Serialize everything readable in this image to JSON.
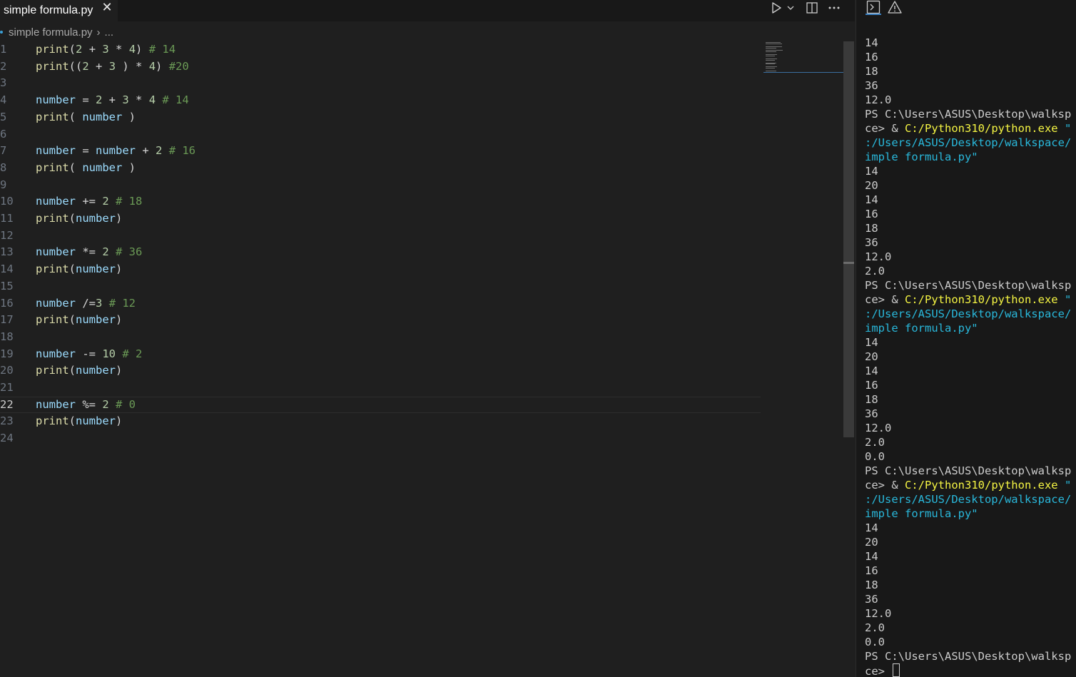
{
  "tab": {
    "label": "simple formula.py",
    "close_glyph": "✕"
  },
  "toolbar": {
    "run_icon": "play-icon",
    "run_dropdown_icon": "chevron-down-icon",
    "split_icon": "split-editor-icon",
    "more_icon": "ellipsis-icon"
  },
  "breadcrumb": {
    "file": "simple formula.py",
    "separator": "›",
    "more": "..."
  },
  "editor": {
    "current_line": 22,
    "lines": [
      {
        "n": "1",
        "tokens": [
          [
            "fn",
            "print"
          ],
          [
            "op",
            "("
          ],
          [
            "num",
            "2"
          ],
          [
            "op",
            " + "
          ],
          [
            "num",
            "3"
          ],
          [
            "op",
            " * "
          ],
          [
            "num",
            "4"
          ],
          [
            "op",
            ") "
          ],
          [
            "com",
            "# 14"
          ]
        ]
      },
      {
        "n": "2",
        "tokens": [
          [
            "fn",
            "print"
          ],
          [
            "op",
            "(("
          ],
          [
            "num",
            "2"
          ],
          [
            "op",
            " + "
          ],
          [
            "num",
            "3"
          ],
          [
            "op",
            " ) * "
          ],
          [
            "num",
            "4"
          ],
          [
            "op",
            ") "
          ],
          [
            "com",
            "#20"
          ]
        ]
      },
      {
        "n": "3",
        "tokens": []
      },
      {
        "n": "4",
        "tokens": [
          [
            "var",
            "number"
          ],
          [
            "op",
            " = "
          ],
          [
            "num",
            "2"
          ],
          [
            "op",
            " + "
          ],
          [
            "num",
            "3"
          ],
          [
            "op",
            " * "
          ],
          [
            "num",
            "4"
          ],
          [
            "op",
            " "
          ],
          [
            "com",
            "# 14"
          ]
        ]
      },
      {
        "n": "5",
        "tokens": [
          [
            "fn",
            "print"
          ],
          [
            "op",
            "( "
          ],
          [
            "var",
            "number"
          ],
          [
            "op",
            " )"
          ]
        ]
      },
      {
        "n": "6",
        "tokens": []
      },
      {
        "n": "7",
        "tokens": [
          [
            "var",
            "number"
          ],
          [
            "op",
            " = "
          ],
          [
            "var",
            "number"
          ],
          [
            "op",
            " + "
          ],
          [
            "num",
            "2"
          ],
          [
            "op",
            " "
          ],
          [
            "com",
            "# 16"
          ]
        ]
      },
      {
        "n": "8",
        "tokens": [
          [
            "fn",
            "print"
          ],
          [
            "op",
            "( "
          ],
          [
            "var",
            "number"
          ],
          [
            "op",
            " )"
          ]
        ]
      },
      {
        "n": "9",
        "tokens": []
      },
      {
        "n": "10",
        "tokens": [
          [
            "var",
            "number"
          ],
          [
            "op",
            " += "
          ],
          [
            "num",
            "2"
          ],
          [
            "op",
            " "
          ],
          [
            "com",
            "# 18"
          ]
        ]
      },
      {
        "n": "11",
        "tokens": [
          [
            "fn",
            "print"
          ],
          [
            "op",
            "("
          ],
          [
            "var",
            "number"
          ],
          [
            "op",
            ")"
          ]
        ]
      },
      {
        "n": "12",
        "tokens": []
      },
      {
        "n": "13",
        "tokens": [
          [
            "var",
            "number"
          ],
          [
            "op",
            " *= "
          ],
          [
            "num",
            "2"
          ],
          [
            "op",
            " "
          ],
          [
            "com",
            "# 36"
          ]
        ]
      },
      {
        "n": "14",
        "tokens": [
          [
            "fn",
            "print"
          ],
          [
            "op",
            "("
          ],
          [
            "var",
            "number"
          ],
          [
            "op",
            ")"
          ]
        ]
      },
      {
        "n": "15",
        "tokens": []
      },
      {
        "n": "16",
        "tokens": [
          [
            "var",
            "number"
          ],
          [
            "op",
            " /="
          ],
          [
            "num",
            "3"
          ],
          [
            "op",
            " "
          ],
          [
            "com",
            "# 12"
          ]
        ]
      },
      {
        "n": "17",
        "tokens": [
          [
            "fn",
            "print"
          ],
          [
            "op",
            "("
          ],
          [
            "var",
            "number"
          ],
          [
            "op",
            ")"
          ]
        ]
      },
      {
        "n": "18",
        "tokens": []
      },
      {
        "n": "19",
        "tokens": [
          [
            "var",
            "number"
          ],
          [
            "op",
            " -= "
          ],
          [
            "num",
            "10"
          ],
          [
            "op",
            " "
          ],
          [
            "com",
            "# 2"
          ]
        ]
      },
      {
        "n": "20",
        "tokens": [
          [
            "fn",
            "print"
          ],
          [
            "op",
            "("
          ],
          [
            "var",
            "number"
          ],
          [
            "op",
            ")"
          ]
        ]
      },
      {
        "n": "21",
        "tokens": []
      },
      {
        "n": "22",
        "tokens": [
          [
            "var",
            "number"
          ],
          [
            "op",
            " %= "
          ],
          [
            "num",
            "2"
          ],
          [
            "op",
            " "
          ],
          [
            "com",
            "# 0"
          ]
        ]
      },
      {
        "n": "23",
        "tokens": [
          [
            "fn",
            "print"
          ],
          [
            "op",
            "("
          ],
          [
            "var",
            "number"
          ],
          [
            "op",
            ")"
          ]
        ]
      },
      {
        "n": "24",
        "tokens": []
      }
    ]
  },
  "terminal": {
    "icons": [
      "terminal-icon",
      "warning-icon"
    ],
    "lines": [
      [
        [
          "plain",
          "14"
        ]
      ],
      [
        [
          "plain",
          "16"
        ]
      ],
      [
        [
          "plain",
          "18"
        ]
      ],
      [
        [
          "plain",
          "36"
        ]
      ],
      [
        [
          "plain",
          "12.0"
        ]
      ],
      [
        [
          "plain",
          "PS C:\\Users\\ASUS\\Desktop\\walkspa"
        ]
      ],
      [
        [
          "plain",
          "ce> & "
        ],
        [
          "exe",
          "C:/Python310/python.exe"
        ],
        [
          "str",
          " \"c"
        ]
      ],
      [
        [
          "str",
          ":/Users/ASUS/Desktop/walkspace/s"
        ]
      ],
      [
        [
          "str",
          "imple formula.py\""
        ]
      ],
      [
        [
          "plain",
          "14"
        ]
      ],
      [
        [
          "plain",
          "20"
        ]
      ],
      [
        [
          "plain",
          "14"
        ]
      ],
      [
        [
          "plain",
          "16"
        ]
      ],
      [
        [
          "plain",
          "18"
        ]
      ],
      [
        [
          "plain",
          "36"
        ]
      ],
      [
        [
          "plain",
          "12.0"
        ]
      ],
      [
        [
          "plain",
          "2.0"
        ]
      ],
      [
        [
          "plain",
          "PS C:\\Users\\ASUS\\Desktop\\walkspa"
        ]
      ],
      [
        [
          "plain",
          "ce> & "
        ],
        [
          "exe",
          "C:/Python310/python.exe"
        ],
        [
          "str",
          " \"c"
        ]
      ],
      [
        [
          "str",
          ":/Users/ASUS/Desktop/walkspace/s"
        ]
      ],
      [
        [
          "str",
          "imple formula.py\""
        ]
      ],
      [
        [
          "plain",
          "14"
        ]
      ],
      [
        [
          "plain",
          "20"
        ]
      ],
      [
        [
          "plain",
          "14"
        ]
      ],
      [
        [
          "plain",
          "16"
        ]
      ],
      [
        [
          "plain",
          "18"
        ]
      ],
      [
        [
          "plain",
          "36"
        ]
      ],
      [
        [
          "plain",
          "12.0"
        ]
      ],
      [
        [
          "plain",
          "2.0"
        ]
      ],
      [
        [
          "plain",
          "0.0"
        ]
      ],
      [
        [
          "plain",
          "PS C:\\Users\\ASUS\\Desktop\\walkspa"
        ]
      ],
      [
        [
          "plain",
          "ce> & "
        ],
        [
          "exe",
          "C:/Python310/python.exe"
        ],
        [
          "str",
          " \"c"
        ]
      ],
      [
        [
          "str",
          ":/Users/ASUS/Desktop/walkspace/s"
        ]
      ],
      [
        [
          "str",
          "imple formula.py\""
        ]
      ],
      [
        [
          "plain",
          "14"
        ]
      ],
      [
        [
          "plain",
          "20"
        ]
      ],
      [
        [
          "plain",
          "14"
        ]
      ],
      [
        [
          "plain",
          "16"
        ]
      ],
      [
        [
          "plain",
          "18"
        ]
      ],
      [
        [
          "plain",
          "36"
        ]
      ],
      [
        [
          "plain",
          "12.0"
        ]
      ],
      [
        [
          "plain",
          "2.0"
        ]
      ],
      [
        [
          "plain",
          "0.0"
        ]
      ],
      [
        [
          "plain",
          "PS C:\\Users\\ASUS\\Desktop\\walkspa"
        ]
      ],
      [
        [
          "plain",
          "ce> "
        ]
      ]
    ]
  },
  "colors": {
    "editor_bg": "#1f1f1f",
    "terminal_bg": "#181818",
    "function": "#dcdcaa",
    "variable": "#9cdcfe",
    "number": "#b5cea8",
    "comment": "#6a9955",
    "terminal_exe": "#f5f543",
    "terminal_string": "#29b8db"
  }
}
